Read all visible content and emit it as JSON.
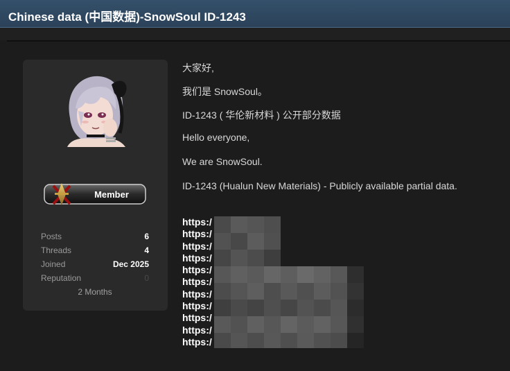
{
  "thread": {
    "title": "Chinese data (中国数据)-SnowSoul ID-1243"
  },
  "author": {
    "rank": "Member",
    "stats": [
      {
        "label": "Posts",
        "value": "6"
      },
      {
        "label": "Threads",
        "value": "4"
      },
      {
        "label": "Joined",
        "value": "Dec 2025"
      },
      {
        "label": "Reputation",
        "value": "0"
      }
    ],
    "tenure": "2 Months"
  },
  "post": {
    "lines": [
      "大家好,",
      "我们是 SnowSoul。",
      "ID-1243 ( 华伦新材料 ) 公开部分数据",
      "Hello everyone,",
      "We are SnowSoul.",
      "ID-1243 (Hualun New Materials) - Publicly available partial data."
    ],
    "links": [
      "https:/",
      "https:/",
      "https:/",
      "https:/",
      "https:/",
      "https:/",
      "https:/",
      "https:/",
      "https:/",
      "https:/",
      "https:/"
    ]
  },
  "icons": {
    "avatar": "anime-avatar-icon",
    "rank": "crossed-swords-icon",
    "redaction": "pixelated-redaction"
  }
}
